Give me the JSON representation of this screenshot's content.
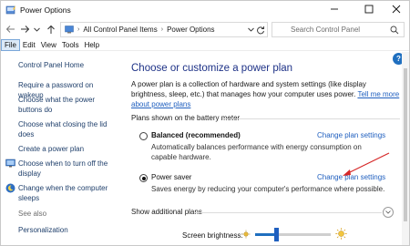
{
  "window": {
    "title": "Power Options",
    "minimize_icon": "minimize-icon",
    "maximize_icon": "maximize-icon",
    "close_icon": "close-icon"
  },
  "address": {
    "crumbs": [
      "All Control Panel Items",
      "Power Options"
    ],
    "search_placeholder": "Search Control Panel"
  },
  "menu": {
    "items": [
      "File",
      "Edit",
      "View",
      "Tools",
      "Help"
    ],
    "active": "File"
  },
  "sidebar": {
    "home": "Control Panel Home",
    "links": [
      "Require a password on wakeup",
      "Choose what the power buttons do",
      "Choose what closing the lid does",
      "Create a power plan",
      "Choose when to turn off the display",
      "Change when the computer sleeps"
    ],
    "see_also": "See also",
    "personalization": "Personalization"
  },
  "main": {
    "title": "Choose or customize a power plan",
    "description": "A power plan is a collection of hardware and system settings (like display brightness, sleep, etc.) that manages how your computer uses power.",
    "description_link": "Tell me more about power plans",
    "group_label": "Plans shown on the battery meter",
    "plans": [
      {
        "name": "Balanced (recommended)",
        "selected": false,
        "link": "Change plan settings",
        "description": "Automatically balances performance with energy consumption on capable hardware."
      },
      {
        "name": "Power saver",
        "selected": true,
        "link": "Change plan settings",
        "description": "Saves energy by reducing your computer's performance where possible."
      }
    ],
    "show_additional": "Show additional plans"
  },
  "brightness": {
    "label": "Screen brightness:",
    "level_percent": 28
  },
  "colors": {
    "title_blue": "#1e3287",
    "link_blue": "#1f5fbf",
    "annotation_red": "#d62828"
  }
}
